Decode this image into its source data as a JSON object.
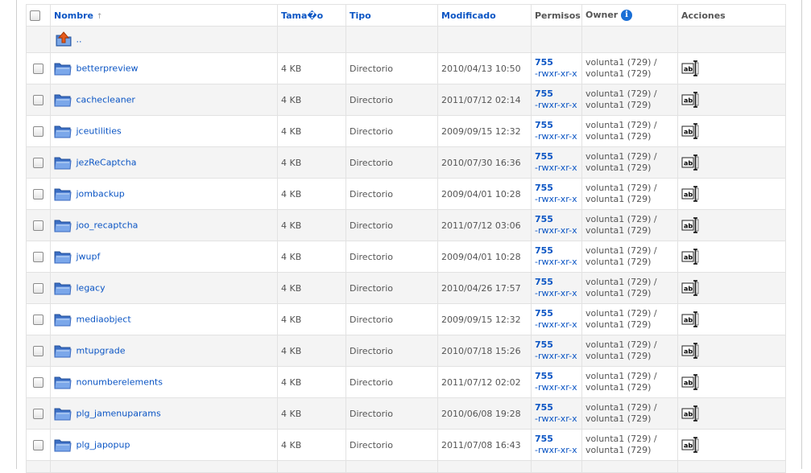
{
  "columns": {
    "name": "Nombre",
    "size": "Tama�o",
    "type": "Tipo",
    "modified": "Modificado",
    "perms": "Permisos",
    "owner": "Owner",
    "actions": "Acciones"
  },
  "sort_indicator": "↑",
  "info_glyph": "i",
  "parent_dir": "..",
  "icons": {
    "folder": "folder-icon",
    "up": "parent-directory-icon",
    "rename": "rename-icon",
    "info": "info-icon"
  },
  "colors": {
    "link": "#0b55c4",
    "folder": "#4a7fd0",
    "alt_row": "#f4f4f4"
  },
  "rows": [
    {
      "name": "betterpreview",
      "size": "4 KB",
      "type": "Directorio",
      "modified": "2010/04/13 10:50",
      "perm_num": "755",
      "perm_str": "-rwxr-xr-x",
      "owner_user": "volunta1 (729) /",
      "owner_group": "volunta1 (729)"
    },
    {
      "name": "cachecleaner",
      "size": "4 KB",
      "type": "Directorio",
      "modified": "2011/07/12 02:14",
      "perm_num": "755",
      "perm_str": "-rwxr-xr-x",
      "owner_user": "volunta1 (729) /",
      "owner_group": "volunta1 (729)"
    },
    {
      "name": "jceutilities",
      "size": "4 KB",
      "type": "Directorio",
      "modified": "2009/09/15 12:32",
      "perm_num": "755",
      "perm_str": "-rwxr-xr-x",
      "owner_user": "volunta1 (729) /",
      "owner_group": "volunta1 (729)"
    },
    {
      "name": "jezReCaptcha",
      "size": "4 KB",
      "type": "Directorio",
      "modified": "2010/07/30 16:36",
      "perm_num": "755",
      "perm_str": "-rwxr-xr-x",
      "owner_user": "volunta1 (729) /",
      "owner_group": "volunta1 (729)"
    },
    {
      "name": "jombackup",
      "size": "4 KB",
      "type": "Directorio",
      "modified": "2009/04/01 10:28",
      "perm_num": "755",
      "perm_str": "-rwxr-xr-x",
      "owner_user": "volunta1 (729) /",
      "owner_group": "volunta1 (729)"
    },
    {
      "name": "joo_recaptcha",
      "size": "4 KB",
      "type": "Directorio",
      "modified": "2011/07/12 03:06",
      "perm_num": "755",
      "perm_str": "-rwxr-xr-x",
      "owner_user": "volunta1 (729) /",
      "owner_group": "volunta1 (729)"
    },
    {
      "name": "jwupf",
      "size": "4 KB",
      "type": "Directorio",
      "modified": "2009/04/01 10:28",
      "perm_num": "755",
      "perm_str": "-rwxr-xr-x",
      "owner_user": "volunta1 (729) /",
      "owner_group": "volunta1 (729)"
    },
    {
      "name": "legacy",
      "size": "4 KB",
      "type": "Directorio",
      "modified": "2010/04/26 17:57",
      "perm_num": "755",
      "perm_str": "-rwxr-xr-x",
      "owner_user": "volunta1 (729) /",
      "owner_group": "volunta1 (729)"
    },
    {
      "name": "mediaobject",
      "size": "4 KB",
      "type": "Directorio",
      "modified": "2009/09/15 12:32",
      "perm_num": "755",
      "perm_str": "-rwxr-xr-x",
      "owner_user": "volunta1 (729) /",
      "owner_group": "volunta1 (729)"
    },
    {
      "name": "mtupgrade",
      "size": "4 KB",
      "type": "Directorio",
      "modified": "2010/07/18 15:26",
      "perm_num": "755",
      "perm_str": "-rwxr-xr-x",
      "owner_user": "volunta1 (729) /",
      "owner_group": "volunta1 (729)"
    },
    {
      "name": "nonumberelements",
      "size": "4 KB",
      "type": "Directorio",
      "modified": "2011/07/12 02:02",
      "perm_num": "755",
      "perm_str": "-rwxr-xr-x",
      "owner_user": "volunta1 (729) /",
      "owner_group": "volunta1 (729)"
    },
    {
      "name": "plg_jamenuparams",
      "size": "4 KB",
      "type": "Directorio",
      "modified": "2010/06/08 19:28",
      "perm_num": "755",
      "perm_str": "-rwxr-xr-x",
      "owner_user": "volunta1 (729) /",
      "owner_group": "volunta1 (729)"
    },
    {
      "name": "plg_japopup",
      "size": "4 KB",
      "type": "Directorio",
      "modified": "2011/07/08 16:43",
      "perm_num": "755",
      "perm_str": "-rwxr-xr-x",
      "owner_user": "volunta1 (729) /",
      "owner_group": "volunta1 (729)"
    }
  ]
}
